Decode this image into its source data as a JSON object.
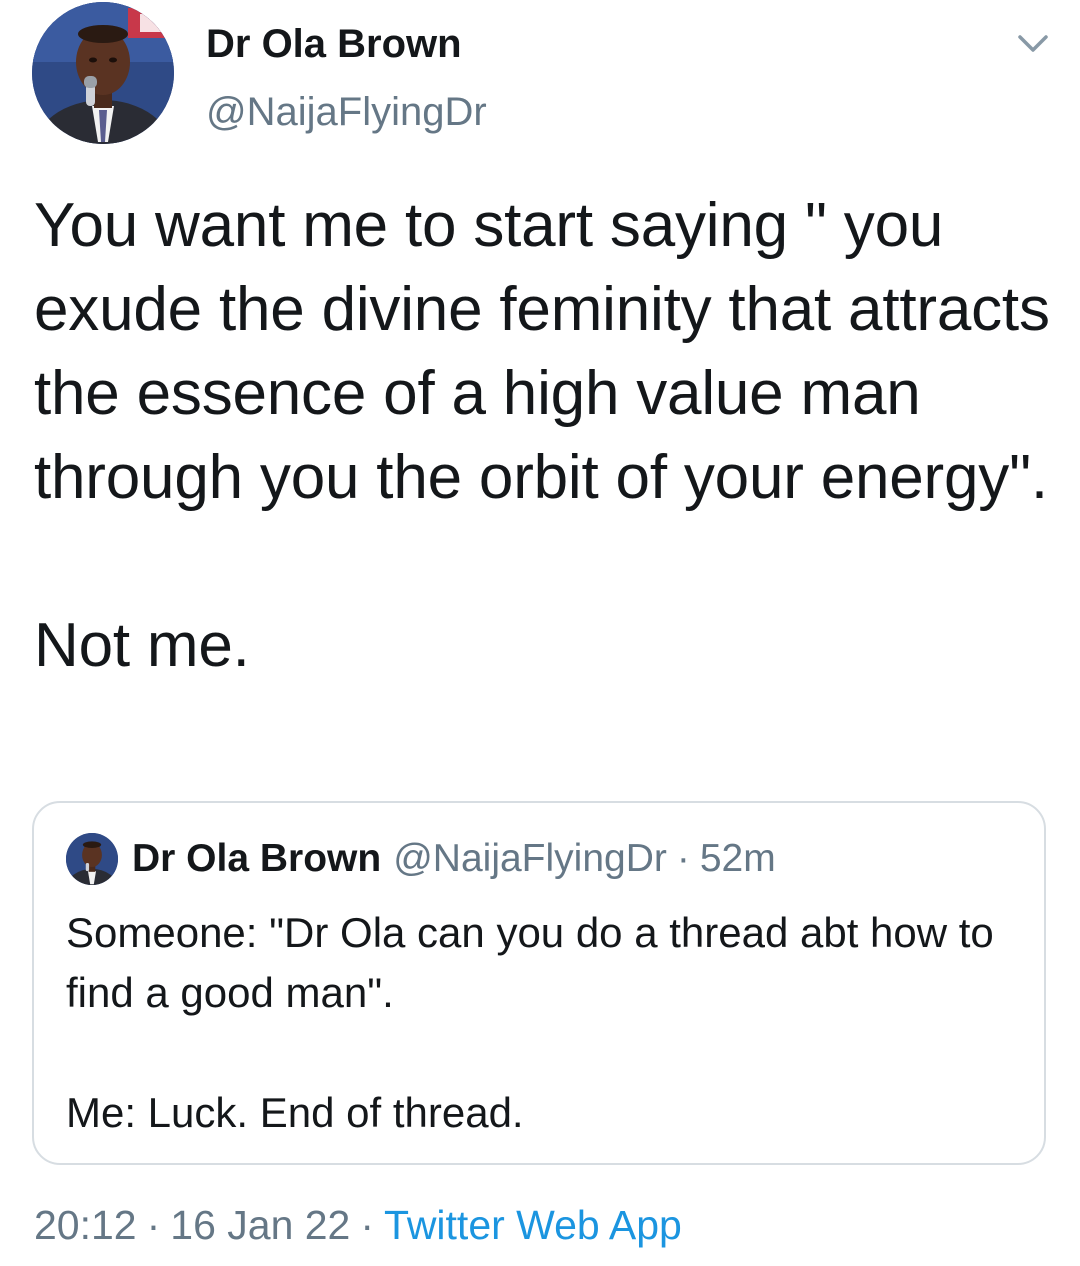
{
  "author": {
    "display_name": "Dr Ola Brown",
    "handle": "@NaijaFlyingDr"
  },
  "tweet": {
    "paragraphs": [
      "You want me to start saying \" you exude the divine feminity that attracts the essence of a high value man through you the orbit of your energy\".",
      "Not me."
    ]
  },
  "quoted_tweet": {
    "display_name": "Dr Ola Brown",
    "handle": "@NaijaFlyingDr",
    "separator": "·",
    "time": "52m",
    "paragraphs": [
      "Someone: \"Dr Ola can you do a thread abt how to find a good man\".",
      "Me: Luck. End of thread."
    ]
  },
  "meta": {
    "time": "20:12",
    "separator": "·",
    "date": "16 Jan 22",
    "source": "Twitter Web App"
  },
  "colors": {
    "text_primary": "#14171a",
    "text_secondary": "#657786",
    "link": "#1b95e0",
    "card_border": "#d7dde2"
  },
  "icons": {
    "menu": "chevron-down-icon"
  }
}
